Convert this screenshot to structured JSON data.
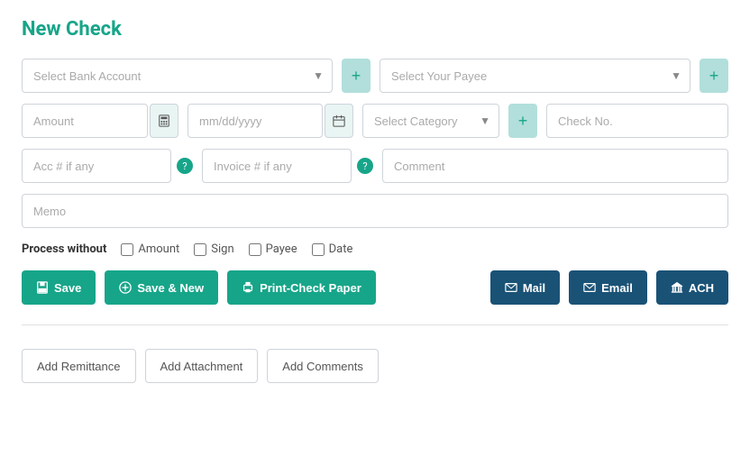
{
  "page": {
    "title": "New Check"
  },
  "row1": {
    "bank_account": {
      "placeholder": "Select Bank Account",
      "options": [
        "Select Bank Account"
      ]
    },
    "payee": {
      "placeholder": "Select Your Payee",
      "options": [
        "Select Your Payee"
      ]
    }
  },
  "row2": {
    "amount": {
      "placeholder": "Amount"
    },
    "date": {
      "placeholder": "mm/dd/yyyy"
    },
    "category": {
      "placeholder": "Select Category",
      "options": [
        "Select Category"
      ]
    },
    "checkno": {
      "placeholder": "Check No."
    }
  },
  "row3": {
    "acc": {
      "placeholder": "Acc # if any"
    },
    "invoice": {
      "placeholder": "Invoice # if any"
    },
    "comment": {
      "placeholder": "Comment"
    }
  },
  "row4": {
    "memo": {
      "placeholder": "Memo"
    }
  },
  "process_without": {
    "label": "Process without",
    "checkboxes": [
      {
        "id": "cb-amount",
        "label": "Amount"
      },
      {
        "id": "cb-sign",
        "label": "Sign"
      },
      {
        "id": "cb-payee",
        "label": "Payee"
      },
      {
        "id": "cb-date",
        "label": "Date"
      }
    ]
  },
  "actions": {
    "save": "Save",
    "save_new": "Save & New",
    "print": "Print-Check Paper",
    "mail": "Mail",
    "email": "Email",
    "ach": "ACH"
  },
  "bottom_actions": {
    "remittance": "Add Remittance",
    "attachment": "Add Attachment",
    "comments": "Add Comments"
  },
  "icons": {
    "save": "💾",
    "plus_circle": "✚",
    "printer": "🖨",
    "mail": "✉",
    "email": "✉",
    "ach": "🏛",
    "calendar": "📅",
    "calculator": "🧮"
  }
}
